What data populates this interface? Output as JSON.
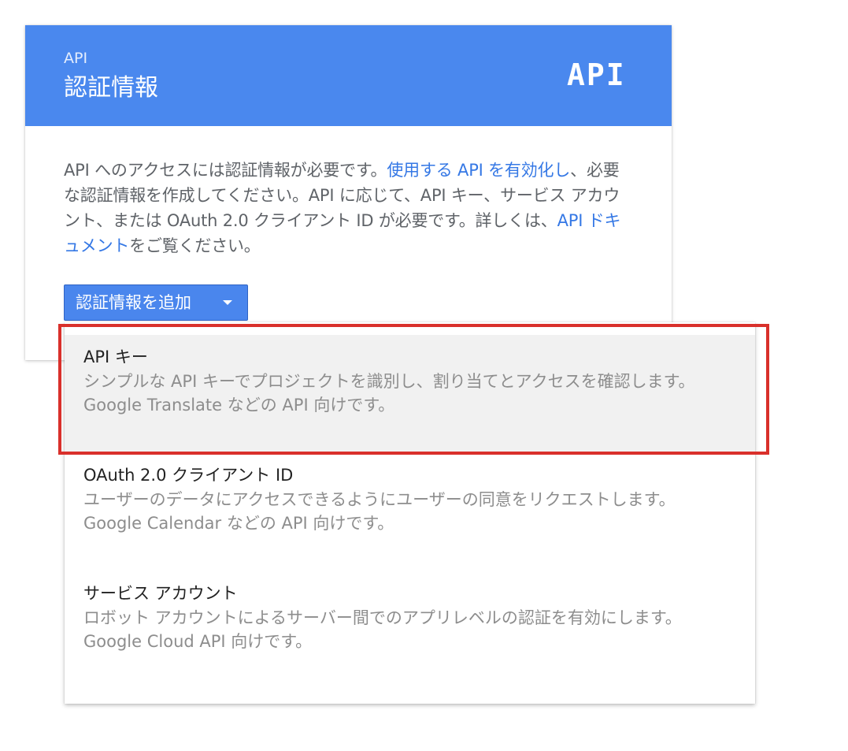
{
  "header": {
    "overline": "API",
    "title": "認証情報",
    "logo_text": "API",
    "color": "#4a88ee"
  },
  "description": {
    "part1": "API へのアクセスには認証情報が必要です。",
    "link1": "使用する API を有効化し",
    "part2": "、必要な認証情報を作成してください。API に応じて、API キー、サービス アカウント、または OAuth 2.0 クライアント ID が必要です。詳しくは、",
    "link2": "API ドキュメント",
    "part3": "をご覧ください。",
    "link_color": "#3578e5"
  },
  "add_button": {
    "label": "認証情報を追加",
    "icon": "caret-down-icon"
  },
  "menu": {
    "items": [
      {
        "title": "API キー",
        "desc": "シンプルな API キーでプロジェクトを識別し、割り当てとアクセスを確認します。",
        "example": "Google Translate などの API 向けです。",
        "highlighted": true
      },
      {
        "title": "OAuth 2.0 クライアント ID",
        "desc": "ユーザーのデータにアクセスできるようにユーザーの同意をリクエストします。",
        "example": "Google Calendar などの API 向けです。",
        "highlighted": false
      },
      {
        "title": "サービス アカウント",
        "desc": "ロボット アカウントによるサーバー間でのアプリレベルの認証を有効にします。",
        "example": "Google Cloud API 向けです。",
        "highlighted": false
      }
    ]
  },
  "annotation": {
    "outline_color": "#d9302b"
  }
}
